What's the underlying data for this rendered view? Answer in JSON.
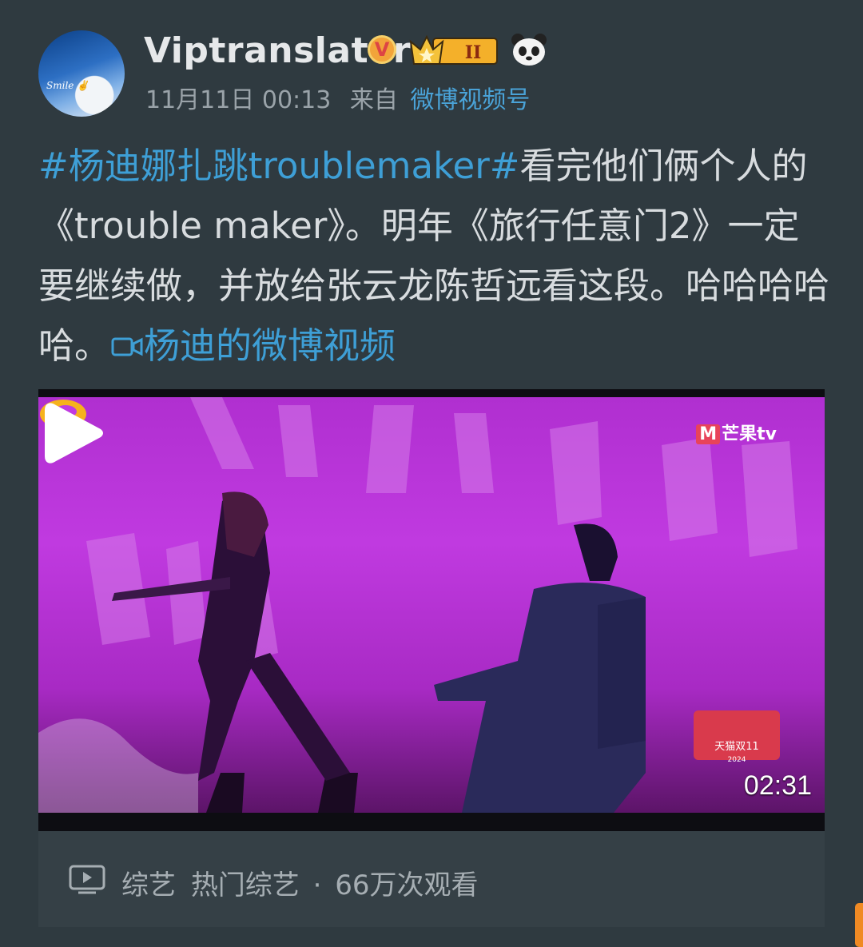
{
  "post": {
    "username": "Viptranslator",
    "verified_icon": "verified-badge-icon",
    "level_badge": "II",
    "timestamp": "11月11日 00:13",
    "source_prefix": "来自",
    "source": "微博视频号",
    "hashtag": "#杨迪娜扎跳troublemaker#",
    "body": "看完他们俩个人的《trouble maker》。明年《旅行任意门2》一定要继续做，并放给张云龙陈哲远看这段。哈哈哈哈哈。",
    "video_link": "杨迪的微博视频"
  },
  "video": {
    "duration": "02:31",
    "mango_logo_text": "芒果tv",
    "tmall_badge": "天猫双11",
    "tmall_year": "2024"
  },
  "footer": {
    "category": "综艺",
    "tag": "热门综艺",
    "separator": "·",
    "views": "66万次观看"
  },
  "colors": {
    "background": "#2f3a40",
    "link": "#3e9fd6",
    "accent": "#f08a24"
  }
}
